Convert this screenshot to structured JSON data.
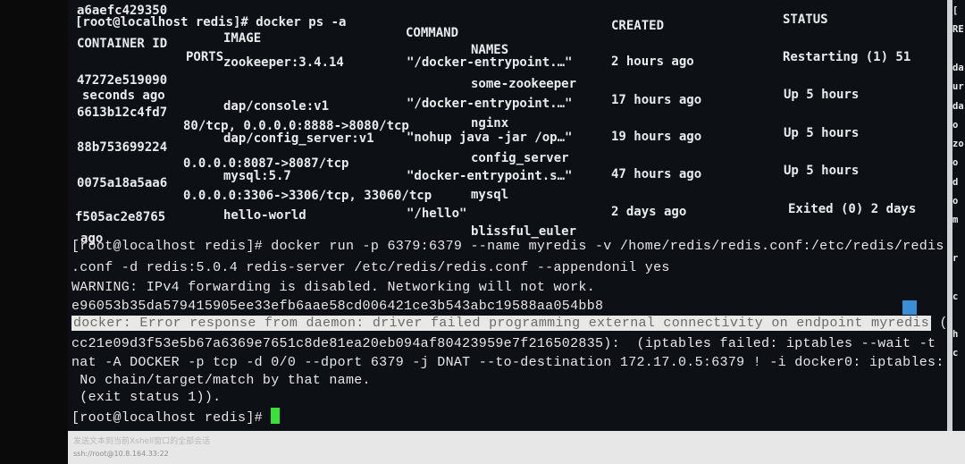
{
  "terminal": {
    "prev_hash": "a6aefc429350",
    "prompt1": "[root@localhost redis]# docker ps -a",
    "headers": {
      "container_id": "CONTAINER ID",
      "image": "IMAGE",
      "command": "COMMAND",
      "created": "CREATED",
      "status": "STATUS",
      "ports": "PORTS",
      "names": "NAMES"
    },
    "containers": [
      {
        "id": "47272e519090",
        "image": "zookeeper:3.4.14",
        "command": "\"/docker-entrypoint.…\"",
        "created": "2 hours ago",
        "status": "Restarting (1) 51",
        "status_cont": "seconds ago",
        "ports": "",
        "name": "some-zookeeper"
      },
      {
        "id": "6613b12c4fd7",
        "image": "dap/console:v1",
        "command": "\"/docker-entrypoint.…\"",
        "created": "17 hours ago",
        "status": "Up 5 hours",
        "ports": "80/tcp, 0.0.0.0:8888->8080/tcp",
        "name": "nginx"
      },
      {
        "id": "88b753699224",
        "image": "dap/config_server:v1",
        "command": "\"nohup java -jar /op…\"",
        "created": "19 hours ago",
        "status": "Up 5 hours",
        "ports": "0.0.0.0:8087->8087/tcp",
        "name": "config_server"
      },
      {
        "id": "0075a18a5aa6",
        "image": "mysql:5.7",
        "command": "\"docker-entrypoint.s…\"",
        "created": "47 hours ago",
        "status": "Up 5 hours",
        "ports": "0.0.0.0:3306->3306/tcp, 33060/tcp",
        "name": "mysql"
      },
      {
        "id": "f505ac2e8765",
        "image": "hello-world",
        "command": "\"/hello\"",
        "created": "2 days ago",
        "status": "Exited (0) 2 days",
        "status_cont": "ago",
        "ports": "",
        "name": "blissful_euler"
      }
    ],
    "lines": [
      "[root@localhost redis]# docker run -p 6379:6379 --name myredis -v /home/redis/redis.conf:/etc/redis/redis",
      ".conf -d redis:5.0.4 redis-server /etc/redis/redis.conf --appendonil yes",
      "WARNING: IPv4 forwarding is disabled. Networking will not work.",
      "e96053b35da579415905ee33efb6aae58cd006421ce3b543abc19588aa054bb8",
      "docker: Error response from daemon: driver failed programming external connectivity on endpoint myredis",
      " (",
      "cc21e09d3f53e5b67a6369e7651c8de81ea20eb094af80423959e7f216502835):  (iptables failed: iptables --wait -t",
      "nat -A DOCKER -p tcp -d 0/0 --dport 6379 -j DNAT --to-destination 172.17.0.5:6379 ! -i docker0: iptables:",
      " No chain/target/match by that name.",
      " (exit status 1)).",
      "[root@localhost redis]# "
    ],
    "cursor_color": "#39e23a"
  },
  "side_panel": {
    "lines": [
      "[",
      "RE",
      "",
      "da",
      "ur",
      "da",
      "o",
      "zo",
      "o",
      "d",
      "o",
      "m",
      "",
      "r",
      "",
      "c",
      "",
      "h",
      "c",
      "",
      ""
    ]
  },
  "bottom_bar": {
    "compose_placeholder": "发送文本到当前Xshell窗口的全部会话",
    "session": "ssh://root@10.8.164.33:22"
  }
}
